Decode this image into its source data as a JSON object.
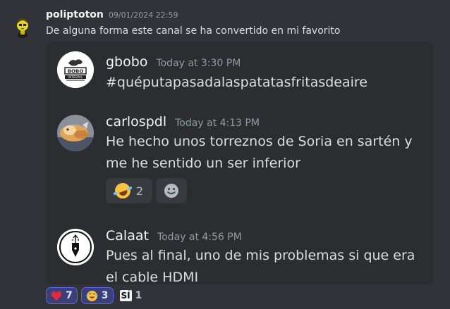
{
  "outer_message": {
    "username": "poliptoton",
    "timestamp": "09/01/2024 22:59",
    "text": "De alguna forma este canal se ha convertido en mi favorito"
  },
  "embed": {
    "messages": [
      {
        "username": "gbobo",
        "timestamp": "Today at 3:30 PM",
        "text": "#quéputapasadalaspatatasfritasdeaire",
        "avatar_icon": "bobo-integral-logo"
      },
      {
        "username": "carlospdl",
        "timestamp": "Today at 4:13 PM",
        "text": "He hecho unos torreznos de Soria en sartén y me he sentido un ser inferior",
        "avatar_icon": "cat-photo",
        "reactions": [
          {
            "emoji": "rolling-on-floor-laughing",
            "count": "2"
          }
        ]
      },
      {
        "username": "Calaat",
        "timestamp": "Today at 4:56 PM",
        "text": "Pues al final, uno de mis problemas si que era el cable HDMI",
        "avatar_icon": "usb-pen-nib-logo"
      }
    ]
  },
  "reactions": [
    {
      "emoji": "heart",
      "count": "7"
    },
    {
      "emoji": "joy",
      "count": "3"
    },
    {
      "emoji": "si-badge",
      "label": "SÍ",
      "count": "1"
    }
  ],
  "colors": {
    "background": "#313338",
    "embed_background": "#2b2d31",
    "accent": "#5865f2",
    "reaction_active": "#3b3f78"
  }
}
